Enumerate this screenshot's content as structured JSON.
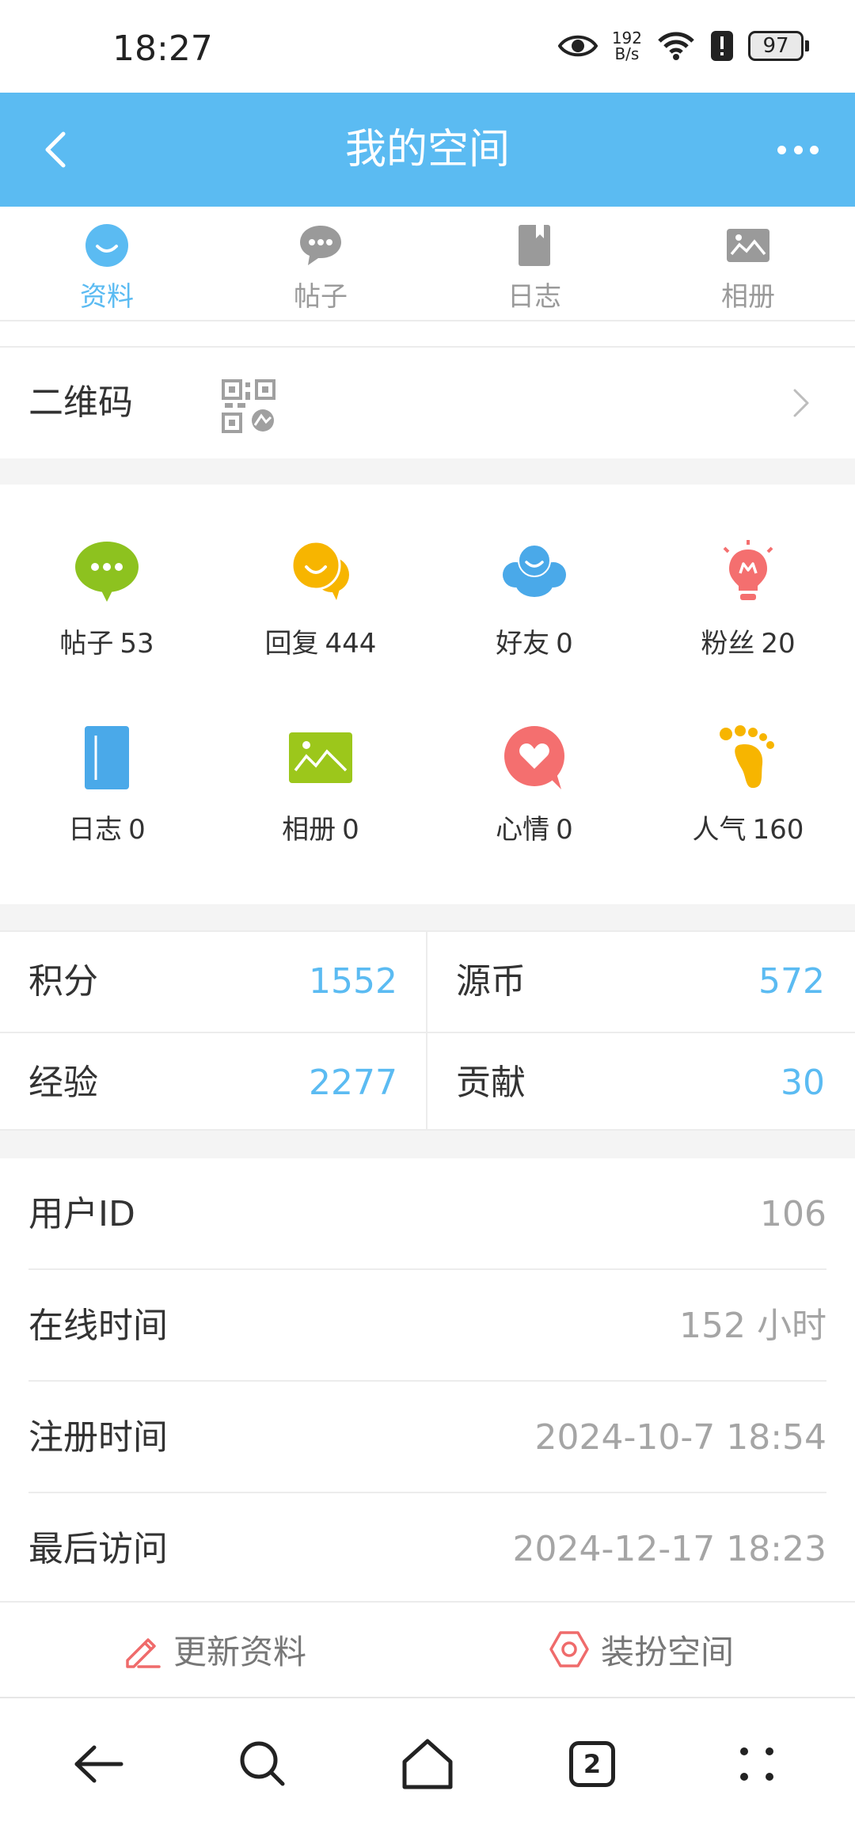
{
  "status_bar": {
    "time": "18:27",
    "net_speed_value": "192",
    "net_speed_unit": "B/s",
    "battery": "97",
    "icons": [
      "eye-icon",
      "wifi-icon",
      "alert-icon",
      "battery-icon"
    ]
  },
  "header": {
    "title": "我的空间",
    "back_icon": "chevron-left-icon",
    "more_icon": "more-dots-icon"
  },
  "tabs": [
    {
      "label": "资料",
      "icon": "smile-icon",
      "active": true
    },
    {
      "label": "帖子",
      "icon": "chat-bubble-icon",
      "active": false
    },
    {
      "label": "日志",
      "icon": "notebook-icon",
      "active": false
    },
    {
      "label": "相册",
      "icon": "photo-icon",
      "active": false
    }
  ],
  "qr_row": {
    "label": "二维码",
    "icon": "qr-code-icon"
  },
  "stats": [
    {
      "label": "帖子",
      "value": "53",
      "icon": "post-bubble-icon",
      "color": "#8dc21f"
    },
    {
      "label": "回复",
      "value": "444",
      "icon": "reply-bubble-icon",
      "color": "#f7b500"
    },
    {
      "label": "好友",
      "value": "0",
      "icon": "friends-icon",
      "color": "#4aa9e9"
    },
    {
      "label": "粉丝",
      "value": "20",
      "icon": "fans-bulb-icon",
      "color": "#f46f6f"
    },
    {
      "label": "日志",
      "value": "0",
      "icon": "diary-icon",
      "color": "#4aa9e9"
    },
    {
      "label": "相册",
      "value": "0",
      "icon": "album-icon",
      "color": "#9cc71b"
    },
    {
      "label": "心情",
      "value": "0",
      "icon": "mood-heart-icon",
      "color": "#f46f6f"
    },
    {
      "label": "人气",
      "value": "160",
      "icon": "footprint-icon",
      "color": "#f7b500"
    }
  ],
  "scores": [
    {
      "label": "积分",
      "value": "1552"
    },
    {
      "label": "源币",
      "value": "572"
    },
    {
      "label": "经验",
      "value": "2277"
    },
    {
      "label": "贡献",
      "value": "30"
    }
  ],
  "info": [
    {
      "label": "用户ID",
      "value": "106"
    },
    {
      "label": "在线时间",
      "value": "152 小时"
    },
    {
      "label": "注册时间",
      "value": "2024-10-7 18:54"
    },
    {
      "label": "最后访问",
      "value": "2024-12-17 18:23"
    }
  ],
  "actions": [
    {
      "label": "更新资料",
      "icon": "edit-pencil-icon"
    },
    {
      "label": "装扮空间",
      "icon": "decorate-hexagon-icon"
    }
  ],
  "system_nav": {
    "tab_count": "2",
    "icons": [
      "back-arrow-icon",
      "search-icon",
      "home-icon",
      "tabs-icon",
      "menu-dots-icon"
    ]
  },
  "colors": {
    "accent": "#5bbbf2",
    "background": "#f4f4f4",
    "value_gray": "#a5a5a5"
  }
}
